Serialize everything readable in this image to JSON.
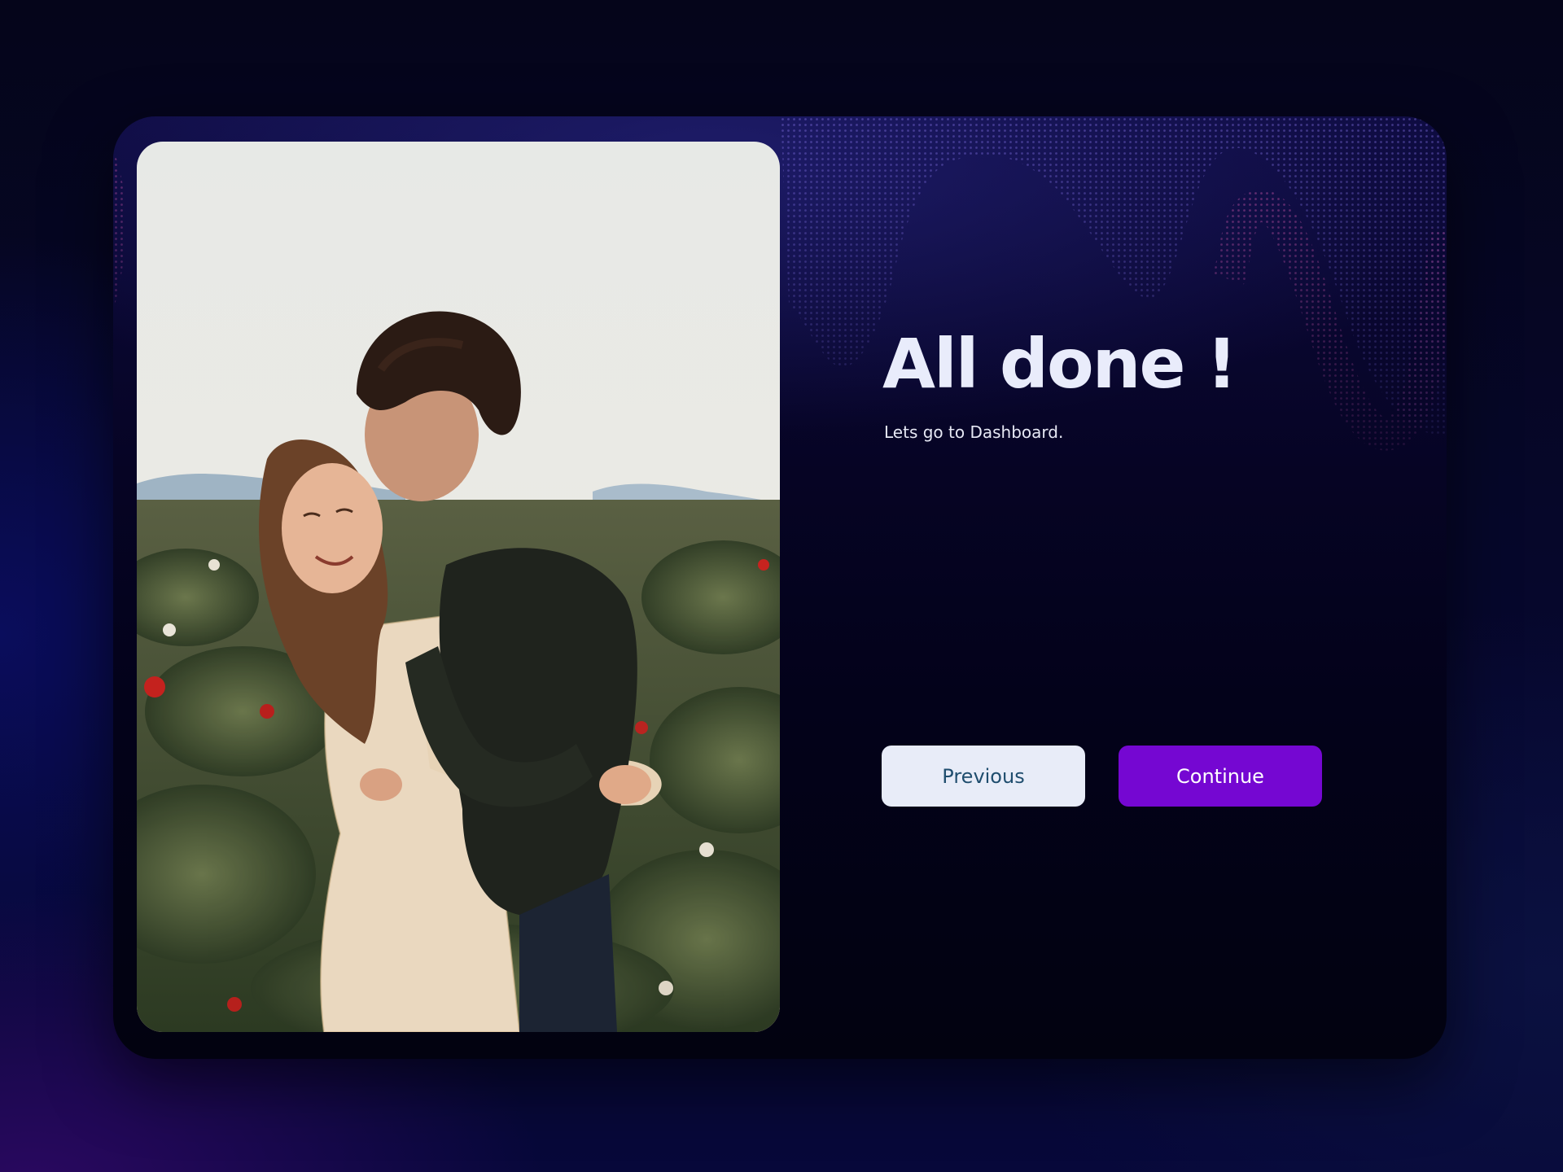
{
  "completion": {
    "title": "All done !",
    "subtitle": "Lets go to Dashboard."
  },
  "actions": {
    "previous_label": "Previous",
    "continue_label": "Continue"
  },
  "photo": {
    "icon": "couple-photo"
  },
  "colors": {
    "page_background": "#06072a",
    "card_background": "#060424",
    "title_text": "#e9ecfb",
    "previous_button_bg": "#e8ecf8",
    "previous_button_text": "#1f4d6e",
    "continue_button_bg": "#7507d2",
    "continue_button_text": "#ffffff"
  }
}
